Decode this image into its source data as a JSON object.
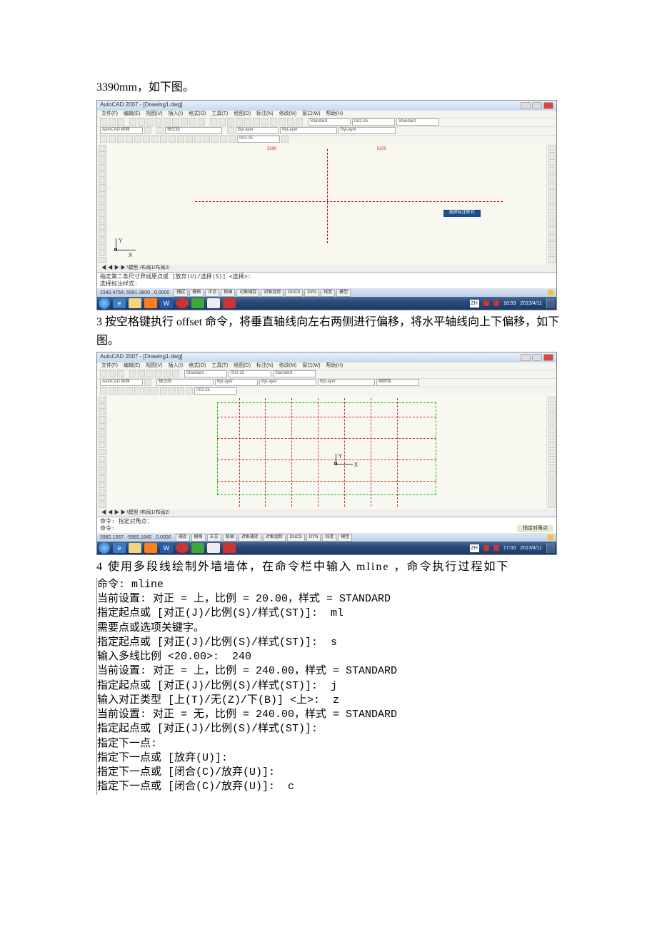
{
  "intro_line": "3390mm，如下图。",
  "cad1": {
    "title": "AutoCAD 2007 - [Drawing1.dwg]",
    "menu": [
      "文件(F)",
      "编辑(E)",
      "视图(V)",
      "插入(I)",
      "格式(O)",
      "工具(T)",
      "绘图(D)",
      "标注(N)",
      "修改(M)",
      "窗口(W)",
      "帮助(H)"
    ],
    "workspace": "AutoCAD 经典",
    "layer": "轴注线",
    "style1": "Standard",
    "dim_style": "ISO-25",
    "style3": "Standard",
    "prop_color": "ByLayer",
    "prop_lt": "ByLayer",
    "dim_a": "3390",
    "dim_b": "5100",
    "tooltip": "选择标注样式",
    "tabs": "◀ ◀ ▶ ▶ \\模型 /布局1/布局2/",
    "cmd1": "指定第二条尺寸界线原点或 [放弃(U)/选择(S)] <选择>:",
    "cmd2": "选择标注样式:",
    "coords": "2340.4754,   5991.3600 , 0.0000",
    "sb_btns": [
      "捕捉",
      "栅格",
      "正交",
      "极轴",
      "对象捕捉",
      "对象追踪",
      "DUCS",
      "DYN",
      "线宽",
      "模型"
    ],
    "tray_lang": "ZH",
    "tray_time": "16:59",
    "tray_date": "2013/4/11"
  },
  "para3": "3 按空格键执行 offset 命令，将垂直轴线向左右两侧进行偏移，将水平轴线向上下偏移，如下图。",
  "cad2": {
    "title": "AutoCAD 2007 - [Drawing1.dwg]",
    "cmd1": "命令: 指定对角点：",
    "cmd2": "命令:",
    "tooltip": "指定对角点",
    "coords": "3982.1567,   -5965.1842 , 0.0000",
    "tray_time": "17:00",
    "tray_date": "2013/4/11",
    "prop_color2": "随颜色"
  },
  "para4": "4 使用多段线绘制外墙墙体，在命令栏中输入 mline ，命令执行过程如下",
  "terminal": "命令: mline\n当前设置: 对正 = 上，比例 = 20.00，样式 = STANDARD\n指定起点或 [对正(J)/比例(S)/样式(ST)]:  ml\n需要点或选项关键字。\n指定起点或 [对正(J)/比例(S)/样式(ST)]:  s\n输入多线比例 <20.00>:  240\n当前设置: 对正 = 上，比例 = 240.00，样式 = STANDARD\n指定起点或 [对正(J)/比例(S)/样式(ST)]:  j\n输入对正类型 [上(T)/无(Z)/下(B)] <上>:  z\n当前设置: 对正 = 无，比例 = 240.00，样式 = STANDARD\n指定起点或 [对正(J)/比例(S)/样式(ST)]:\n指定下一点:\n指定下一点或 [放弃(U)]:\n指定下一点或 [闭合(C)/放弃(U)]:\n指定下一点或 [闭合(C)/放弃(U)]:  c"
}
